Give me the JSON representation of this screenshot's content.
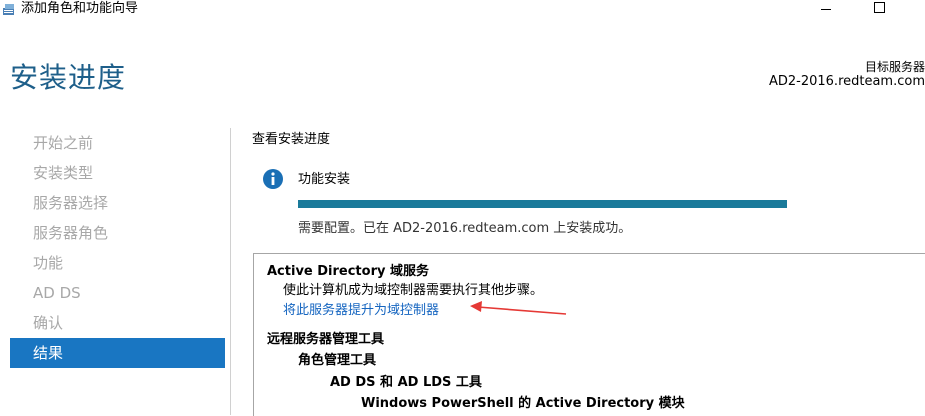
{
  "window": {
    "title": "添加角色和功能向导"
  },
  "header": {
    "page_title": "安装进度",
    "target_label": "目标服务器",
    "target_value": "AD2-2016.redteam.com"
  },
  "nav": {
    "items": [
      {
        "label": "开始之前",
        "active": false
      },
      {
        "label": "安装类型",
        "active": false
      },
      {
        "label": "服务器选择",
        "active": false
      },
      {
        "label": "服务器角色",
        "active": false
      },
      {
        "label": "功能",
        "active": false
      },
      {
        "label": "AD DS",
        "active": false
      },
      {
        "label": "确认",
        "active": false
      },
      {
        "label": "结果",
        "active": true
      }
    ]
  },
  "content": {
    "section_label": "查看安装进度",
    "feature_label": "功能安装",
    "progress": 1.0,
    "status_text": "需要配置。已在 AD2-2016.redteam.com 上安装成功。"
  },
  "results": {
    "adds_title": "Active Directory 域服务",
    "adds_desc": "使此计算机成为域控制器需要执行其他步骤。",
    "promote_link": "将此服务器提升为域控制器",
    "rsat_title": "远程服务器管理工具",
    "role_tools": "角色管理工具",
    "adds_tools": "AD DS 和 AD LDS 工具",
    "ps_module": "Windows PowerShell 的 Active Directory 模块"
  },
  "colors": {
    "accent": "#1976c2",
    "title": "#1e5f8a",
    "progress": "#1a7a9a",
    "link": "#1565c0",
    "arrow": "#e53935"
  }
}
